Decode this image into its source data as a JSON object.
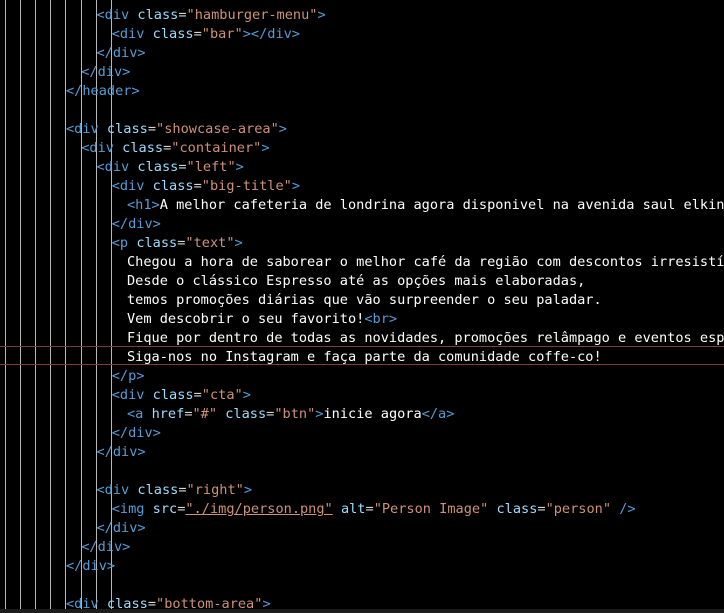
{
  "editor": {
    "lines": [
      {
        "indent": 6,
        "tokens": [
          [
            "tag",
            "<div "
          ],
          [
            "attr",
            "class"
          ],
          [
            "eq",
            "="
          ],
          [
            "str",
            "\"hamburger-menu\""
          ],
          [
            "tag",
            ">"
          ]
        ]
      },
      {
        "indent": 7,
        "tokens": [
          [
            "tag",
            "<div "
          ],
          [
            "attr",
            "class"
          ],
          [
            "eq",
            "="
          ],
          [
            "str",
            "\"bar\""
          ],
          [
            "tag",
            "></div>"
          ]
        ]
      },
      {
        "indent": 6,
        "tokens": [
          [
            "tag",
            "</div>"
          ]
        ]
      },
      {
        "indent": 5,
        "tokens": [
          [
            "tag",
            "</div>"
          ]
        ]
      },
      {
        "indent": 4,
        "tokens": [
          [
            "tag",
            "</header>"
          ]
        ]
      },
      {
        "indent": 0,
        "tokens": []
      },
      {
        "indent": 4,
        "tokens": [
          [
            "tag",
            "<div "
          ],
          [
            "attr",
            "class"
          ],
          [
            "eq",
            "="
          ],
          [
            "str",
            "\"showcase-area\""
          ],
          [
            "tag",
            ">"
          ]
        ]
      },
      {
        "indent": 5,
        "tokens": [
          [
            "tag",
            "<div "
          ],
          [
            "attr",
            "class"
          ],
          [
            "eq",
            "="
          ],
          [
            "str",
            "\"container\""
          ],
          [
            "tag",
            ">"
          ]
        ]
      },
      {
        "indent": 6,
        "tokens": [
          [
            "tag",
            "<div "
          ],
          [
            "attr",
            "class"
          ],
          [
            "eq",
            "="
          ],
          [
            "str",
            "\"left\""
          ],
          [
            "tag",
            ">"
          ]
        ]
      },
      {
        "indent": 7,
        "tokens": [
          [
            "tag",
            "<div "
          ],
          [
            "attr",
            "class"
          ],
          [
            "eq",
            "="
          ],
          [
            "str",
            "\"big-title\""
          ],
          [
            "tag",
            ">"
          ]
        ]
      },
      {
        "indent": 8,
        "tokens": [
          [
            "tag",
            "<h1>"
          ],
          [
            "txt",
            "A melhor cafeteria de londrina agora disponivel na avenida saul elkind"
          ],
          [
            "tag",
            "</h1>"
          ]
        ]
      },
      {
        "indent": 7,
        "tokens": [
          [
            "tag",
            "</div>"
          ]
        ]
      },
      {
        "indent": 7,
        "tokens": [
          [
            "tag",
            "<p "
          ],
          [
            "attr",
            "class"
          ],
          [
            "eq",
            "="
          ],
          [
            "str",
            "\"text\""
          ],
          [
            "tag",
            ">"
          ]
        ]
      },
      {
        "indent": 8,
        "tokens": [
          [
            "txt",
            "Chegou a hora de saborear o melhor café da região com descontos irresistíveis!"
          ]
        ]
      },
      {
        "indent": 8,
        "tokens": [
          [
            "txt",
            "Desde o clássico Espresso até as opções mais elaboradas,"
          ]
        ]
      },
      {
        "indent": 8,
        "tokens": [
          [
            "txt",
            "temos promoções diárias que vão surpreender o seu paladar."
          ]
        ]
      },
      {
        "indent": 8,
        "tokens": [
          [
            "txt",
            "Vem descobrir o seu favorito!"
          ],
          [
            "tag",
            "<br>"
          ]
        ]
      },
      {
        "indent": 8,
        "tokens": [
          [
            "txt",
            "Fique por dentro de todas as novidades, promoções relâmpago e eventos especiais"
          ]
        ]
      },
      {
        "indent": 8,
        "tokens": [
          [
            "txt",
            "Siga-nos no Instagram e faça parte da comunidade coffe-co!"
          ]
        ]
      },
      {
        "indent": 7,
        "tokens": [
          [
            "tag",
            "</p>"
          ]
        ]
      },
      {
        "indent": 7,
        "tokens": [
          [
            "tag",
            "<div "
          ],
          [
            "attr",
            "class"
          ],
          [
            "eq",
            "="
          ],
          [
            "str",
            "\"cta\""
          ],
          [
            "tag",
            ">"
          ]
        ]
      },
      {
        "indent": 8,
        "tokens": [
          [
            "tag",
            "<a "
          ],
          [
            "attr",
            "href"
          ],
          [
            "eq",
            "="
          ],
          [
            "str",
            "\"#\""
          ],
          [
            "txt",
            " "
          ],
          [
            "attr",
            "class"
          ],
          [
            "eq",
            "="
          ],
          [
            "str",
            "\"btn\""
          ],
          [
            "tag",
            ">"
          ],
          [
            "txt",
            "inicie agora"
          ],
          [
            "tag",
            "</a>"
          ]
        ]
      },
      {
        "indent": 7,
        "tokens": [
          [
            "tag",
            "</div>"
          ]
        ]
      },
      {
        "indent": 6,
        "tokens": [
          [
            "tag",
            "</div>"
          ]
        ]
      },
      {
        "indent": 0,
        "tokens": []
      },
      {
        "indent": 6,
        "tokens": [
          [
            "tag",
            "<div "
          ],
          [
            "attr",
            "class"
          ],
          [
            "eq",
            "="
          ],
          [
            "str",
            "\"right\""
          ],
          [
            "tag",
            ">"
          ]
        ]
      },
      {
        "indent": 7,
        "tokens": [
          [
            "tag",
            "<img "
          ],
          [
            "attr",
            "src"
          ],
          [
            "eq",
            "="
          ],
          [
            "strlink",
            "\"./img/person.png\""
          ],
          [
            "txt",
            " "
          ],
          [
            "attr",
            "alt"
          ],
          [
            "eq",
            "="
          ],
          [
            "str",
            "\"Person Image\""
          ],
          [
            "txt",
            " "
          ],
          [
            "attr",
            "class"
          ],
          [
            "eq",
            "="
          ],
          [
            "str",
            "\"person\""
          ],
          [
            "txt",
            " "
          ],
          [
            "tag",
            "/>"
          ]
        ]
      },
      {
        "indent": 6,
        "tokens": [
          [
            "tag",
            "</div>"
          ]
        ]
      },
      {
        "indent": 5,
        "tokens": [
          [
            "tag",
            "</div>"
          ]
        ]
      },
      {
        "indent": 4,
        "tokens": [
          [
            "tag",
            "</div>"
          ]
        ]
      },
      {
        "indent": 0,
        "tokens": []
      },
      {
        "indent": 4,
        "tokens": [
          [
            "tag",
            "<div "
          ],
          [
            "attr",
            "class"
          ],
          [
            "eq",
            "="
          ],
          [
            "str",
            "\"bottom-area\""
          ],
          [
            "tag",
            ">"
          ]
        ]
      }
    ]
  }
}
